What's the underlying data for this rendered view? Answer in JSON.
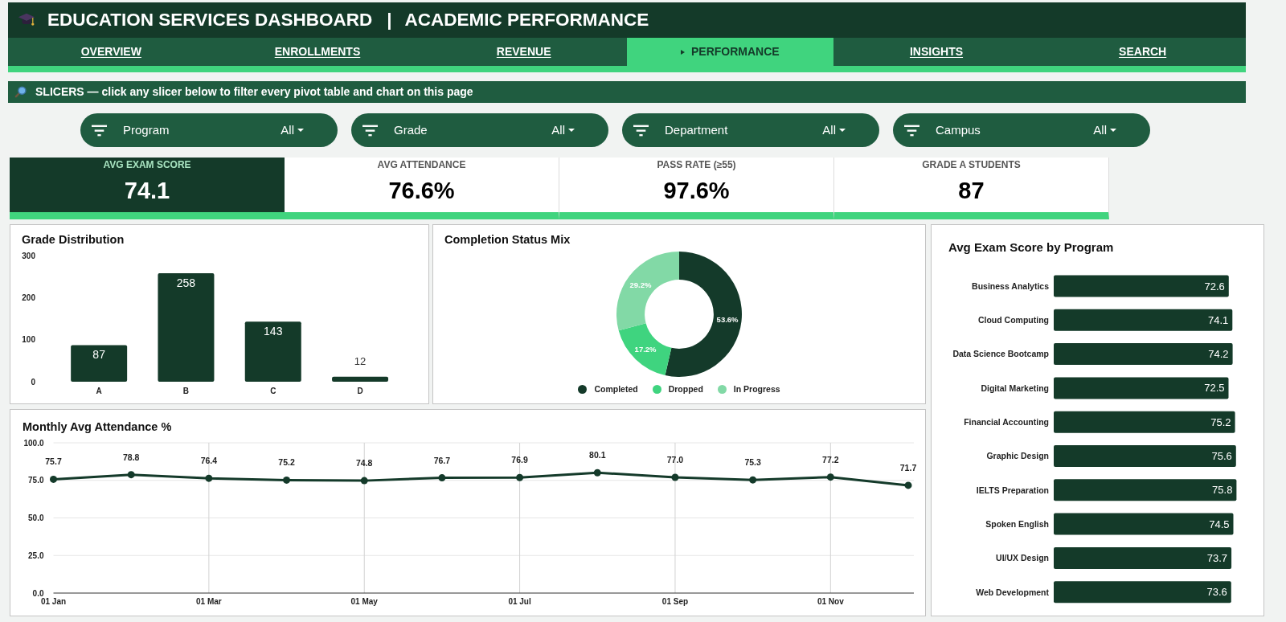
{
  "header": {
    "title": "EDUCATION SERVICES DASHBOARD",
    "separator": "|",
    "subtitle": "ACADEMIC PERFORMANCE"
  },
  "nav": [
    {
      "label": "OVERVIEW",
      "selected": false
    },
    {
      "label": "ENROLLMENTS",
      "selected": false
    },
    {
      "label": "REVENUE",
      "selected": false
    },
    {
      "label": "PERFORMANCE",
      "selected": true
    },
    {
      "label": "INSIGHTS",
      "selected": false
    },
    {
      "label": "SEARCH",
      "selected": false
    }
  ],
  "slicer_banner": {
    "text": "SLICERS — click any slicer below to filter every pivot table and chart on this page"
  },
  "slicers": [
    {
      "label": "Program",
      "value": "All"
    },
    {
      "label": "Grade",
      "value": "All"
    },
    {
      "label": "Department",
      "value": "All"
    },
    {
      "label": "Campus",
      "value": "All"
    }
  ],
  "kpis": [
    {
      "label": "AVG EXAM SCORE",
      "value": "74.1",
      "highlighted": true
    },
    {
      "label": "AVG ATTENDANCE",
      "value": "76.6%",
      "highlighted": false
    },
    {
      "label": "PASS RATE (≥55)",
      "value": "97.6%",
      "highlighted": false
    },
    {
      "label": "GRADE A STUDENTS",
      "value": "87",
      "highlighted": false
    }
  ],
  "grade_distribution": {
    "title": "Grade Distribution",
    "chart_data": {
      "type": "bar",
      "categories": [
        "A",
        "B",
        "C",
        "D"
      ],
      "values": [
        87,
        258,
        143,
        12
      ],
      "ylim": [
        0,
        300
      ],
      "yticks": [
        0,
        100,
        200,
        300
      ],
      "value_labels": [
        "87",
        "258",
        "143",
        "12"
      ]
    }
  },
  "completion_status": {
    "title": "Completion Status Mix",
    "chart_data": {
      "type": "donut",
      "categories": [
        "Completed",
        "Dropped",
        "In Progress"
      ],
      "values": [
        53.6,
        17.2,
        29.2
      ],
      "colors": [
        "#143a2a",
        "#3fd47f",
        "#82d9a6"
      ],
      "value_labels": [
        "53.6%",
        "17.2%",
        "29.2%"
      ],
      "legend": "bottom"
    }
  },
  "score_by_program": {
    "title": "Avg Exam Score by Program",
    "chart_data": {
      "type": "bar",
      "orientation": "horizontal",
      "categories": [
        "Business Analytics",
        "Cloud Computing",
        "Data Science Bootcamp",
        "Digital Marketing",
        "Financial Accounting",
        "Graphic Design",
        "IELTS Preparation",
        "Spoken English",
        "UI/UX Design",
        "Web Development"
      ],
      "values": [
        72.6,
        74.1,
        74.2,
        72.5,
        75.2,
        75.6,
        75.8,
        74.5,
        73.7,
        73.6
      ],
      "value_labels": [
        "72.6",
        "74.1",
        "74.2",
        "72.5",
        "75.2",
        "75.6",
        "75.8",
        "74.5",
        "73.7",
        "73.6"
      ]
    }
  },
  "monthly_attendance": {
    "title": "Monthly Avg Attendance %",
    "chart_data": {
      "type": "line",
      "categories": [
        "01 Jan",
        null,
        "01 Mar",
        null,
        "01 May",
        null,
        "01 Jul",
        null,
        "01 Sep",
        null,
        "01 Nov",
        null
      ],
      "series": [
        {
          "color": "#143a2a",
          "marker": true,
          "values": [
            75.7,
            78.8,
            76.4,
            75.2,
            74.8,
            76.7,
            76.9,
            80.1,
            77.0,
            75.3,
            77.2,
            71.7
          ]
        }
      ],
      "ylim": [
        0,
        100
      ],
      "yticks": [
        {
          "value": 0,
          "label": "0.0"
        },
        {
          "value": 25,
          "label": "25.0"
        },
        {
          "value": 50,
          "label": "50.0"
        },
        {
          "value": 75,
          "label": "75.0"
        },
        {
          "value": 100,
          "label": "100.0"
        }
      ],
      "grid": true,
      "value_labels": [
        "75.7",
        "78.8",
        "76.4",
        "75.2",
        "74.8",
        "76.7",
        "76.9",
        "80.1",
        "77.0",
        "75.3",
        "77.2",
        "71.7"
      ]
    }
  }
}
